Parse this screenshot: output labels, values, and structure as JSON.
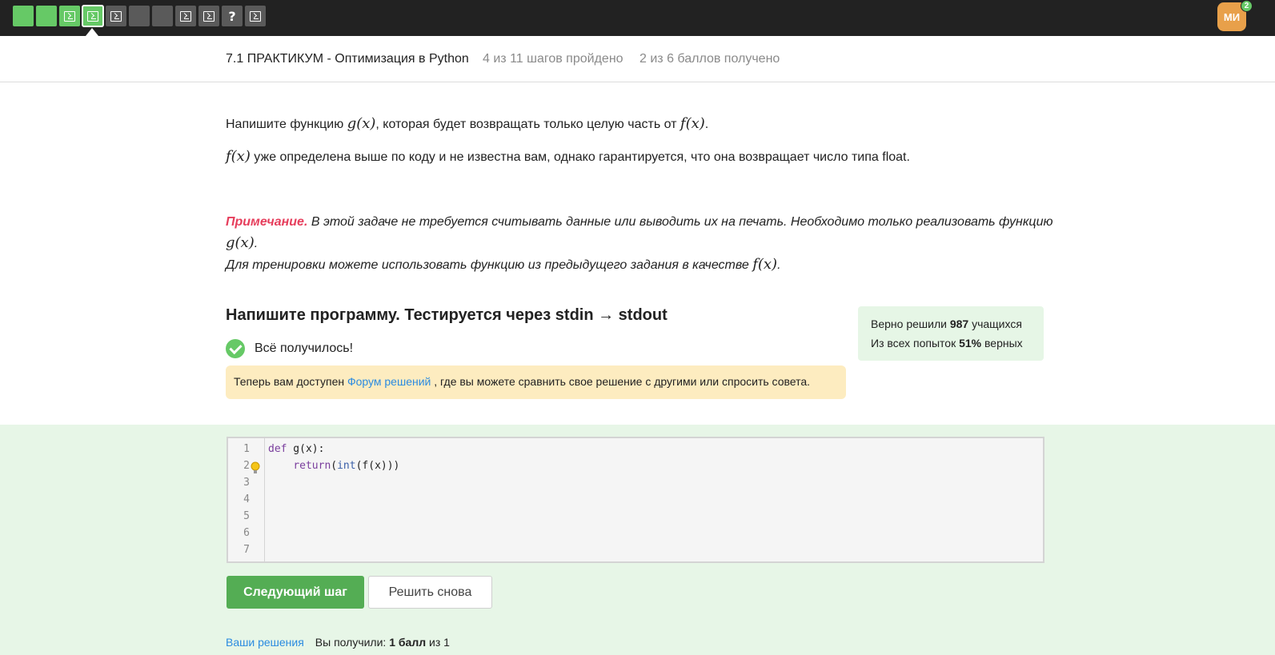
{
  "topbar": {
    "steps": [
      {
        "kind": "text",
        "state": "done"
      },
      {
        "kind": "text",
        "state": "done"
      },
      {
        "kind": "code",
        "state": "done"
      },
      {
        "kind": "code",
        "state": "done-active"
      },
      {
        "kind": "code",
        "state": "todo"
      },
      {
        "kind": "text",
        "state": "todo"
      },
      {
        "kind": "text",
        "state": "todo"
      },
      {
        "kind": "code",
        "state": "todo"
      },
      {
        "kind": "code",
        "state": "todo"
      },
      {
        "kind": "question",
        "state": "todo"
      },
      {
        "kind": "code",
        "state": "todo"
      }
    ],
    "question_glyph": "?",
    "avatar": {
      "initials": "МИ",
      "badge": "2",
      "color": "#e8a04a"
    }
  },
  "lesson": {
    "title": "7.1 ПРАКТИКУМ - Оптимизация в Python",
    "progress": "4 из 11 шагов пройдено",
    "points": "2 из 6 баллов  получено"
  },
  "task": {
    "p1_before": "Напишите функцию ",
    "p1_g": "g(x)",
    "p1_mid": ", которая будет возвращать только целую часть от ",
    "p1_f": "f(x)",
    "p1_end": ".",
    "p2_f": "f(x)",
    "p2_text": " уже определена выше по коду и не известна вам, однако гарантируется, что она возвращает число типа float."
  },
  "note": {
    "label": "Примечание.",
    "line1": " В этой задаче не требуется считывать данные или выводить их на печать. Необходимо только реализовать функцию ",
    "line1_g": "g(x)",
    "line1_end": ".",
    "line2": "Для тренировки можете использовать функцию из предыдущего задания в качестве ",
    "line2_f": "f(x)",
    "line2_end": "."
  },
  "program": {
    "title": "Напишите программу. Тестируется через stdin → stdout",
    "success": "Всё получилось!",
    "forum_before": "Теперь вам доступен ",
    "forum_link": "Форум решений",
    "forum_after": " , где вы можете сравнить свое решение с другими или спросить совета."
  },
  "stats": {
    "solved_before": "Верно решили ",
    "solved_count": "987",
    "solved_after": " учащихся",
    "attempts_before": "Из всех попыток ",
    "attempts_pct": "51%",
    "attempts_after": " верных"
  },
  "editor": {
    "line_numbers": [
      "1",
      "2",
      "3",
      "4",
      "5",
      "6",
      "7"
    ],
    "line1_kw": "def",
    "line1_rest": " g(x):",
    "line2_indent": "    ",
    "line2_kw": "return",
    "line2_open": "(",
    "line2_bi": "int",
    "line2_rest": "(f(x)))"
  },
  "buttons": {
    "next": "Следующий шаг",
    "retry": "Решить снова"
  },
  "footer": {
    "your_solutions": "Ваши решения",
    "score_before": "Вы получили: ",
    "score_bold": "1 балл",
    "score_after": " из 1"
  },
  "colors": {
    "accent_green": "#54ad54",
    "step_green": "#66c966",
    "note_red": "#e63e5c",
    "link_blue": "#2b8be0",
    "forum_bg": "#fdecc0",
    "code_section_bg": "#e7f6e7"
  }
}
